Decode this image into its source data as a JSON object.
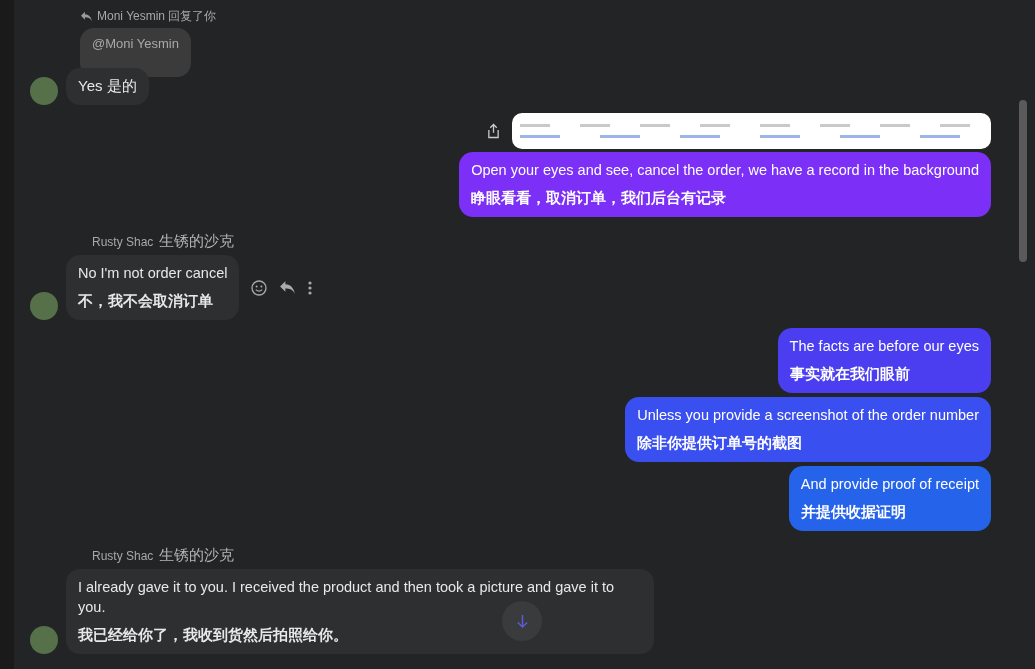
{
  "messages": [
    {
      "kind": "incoming",
      "reply_header": "Moni Yesmin 回复了你",
      "quote": "@Moni Yesmin",
      "text": "Yes  是的",
      "actions": false
    },
    {
      "kind": "outgoing",
      "attachment": true,
      "text_en": "Open your eyes and see, cancel the order, we have a record in the background",
      "text_zh": "睁眼看看，取消订单，我们后台有记录",
      "color": "#7b2ff7"
    },
    {
      "kind": "incoming",
      "sender": "Rusty Shac",
      "sender_alias": "生锈的沙克",
      "text_en": "No I'm not order cancel",
      "text_zh": "不，我不会取消订单",
      "actions": true
    },
    {
      "kind": "outgoing",
      "attachment": false,
      "text_en": "The facts are before our eyes",
      "text_zh": "事实就在我们眼前",
      "color": "#4a3ef0"
    },
    {
      "kind": "outgoing",
      "attachment": false,
      "text_en": "Unless you provide a screenshot of the order number",
      "text_zh": "除非你提供订单号的截图",
      "color": "#3a4ff0"
    },
    {
      "kind": "outgoing",
      "attachment": false,
      "text_en": "And provide proof of receipt",
      "text_zh": "并提供收据证明",
      "color": "#2563eb"
    },
    {
      "kind": "incoming",
      "sender": "Rusty Shac",
      "sender_alias": "生锈的沙克",
      "text_en": "I already gave it to you. I received the product and then took a picture and gave it to you.",
      "text_zh": "我已经给你了，我收到货然后拍照给你。",
      "actions": false
    }
  ]
}
